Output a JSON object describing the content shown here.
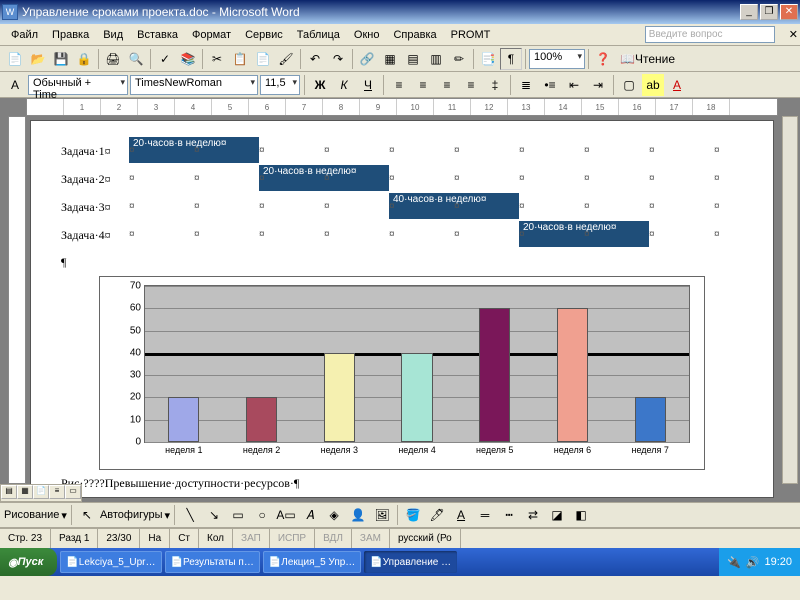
{
  "window": {
    "title": "Управление сроками проекта.doc - Microsoft Word",
    "icon": "W"
  },
  "menu": [
    "Файл",
    "Правка",
    "Вид",
    "Вставка",
    "Формат",
    "Сервис",
    "Таблица",
    "Окно",
    "Справка",
    "PROMT"
  ],
  "ask_placeholder": "Введите вопрос",
  "toolbar1": {
    "zoom": "100%",
    "read_label": "Чтение"
  },
  "formatbar": {
    "style": "Обычный + Time",
    "font": "TimesNewRoman",
    "size": "11,5"
  },
  "ruler_marks": [
    "",
    "1",
    "2",
    "3",
    "4",
    "5",
    "6",
    "7",
    "8",
    "9",
    "10",
    "11",
    "12",
    "13",
    "14",
    "15",
    "16",
    "17",
    "18"
  ],
  "gantt": {
    "rows": [
      {
        "label": "Задача·1¤",
        "start": 0,
        "len": 130,
        "text": "20·часов·в неделю¤"
      },
      {
        "label": "Задача·2¤",
        "start": 130,
        "len": 130,
        "text": "20·часов·в неделю¤"
      },
      {
        "label": "Задача·3¤",
        "start": 260,
        "len": 130,
        "text": "40·часов·в неделю¤"
      },
      {
        "label": "Задача·4¤",
        "start": 390,
        "len": 130,
        "text": "20·часов·в неделю¤"
      }
    ]
  },
  "caption": "Рис·????Превышение·доступности·ресурсов·¶",
  "chart_data": {
    "type": "bar",
    "categories": [
      "неделя 1",
      "неделя 2",
      "неделя 3",
      "неделя 4",
      "неделя 5",
      "неделя 6",
      "неделя 7"
    ],
    "values": [
      20,
      20,
      40,
      40,
      60,
      60,
      20
    ],
    "colors": [
      "#9fa8e8",
      "#a84a5e",
      "#f5f0b0",
      "#a7e5d5",
      "#7a1759",
      "#f0a090",
      "#3c77c9"
    ],
    "ylim": [
      0,
      70
    ],
    "yticks": [
      0,
      10,
      20,
      30,
      40,
      50,
      60,
      70
    ],
    "threshold": 40
  },
  "drawbar": {
    "label1": "Рисование",
    "label2": "Автофигуры"
  },
  "status": {
    "page": "Стр. 23",
    "sect": "Разд 1",
    "pg": "23/30",
    "at": "На",
    "ln": "Ст",
    "col": "Кол",
    "rec": "ЗАП",
    "isp": "ИСПР",
    "vdl": "ВДЛ",
    "zam": "ЗАМ",
    "lang": "русский (Ро"
  },
  "taskbar": {
    "start": "Пуск",
    "items": [
      "Lekciya_5_Upr…",
      "Результаты п…",
      "Лекция_5 Упр…",
      "Управление …"
    ],
    "clock": "19:20"
  }
}
